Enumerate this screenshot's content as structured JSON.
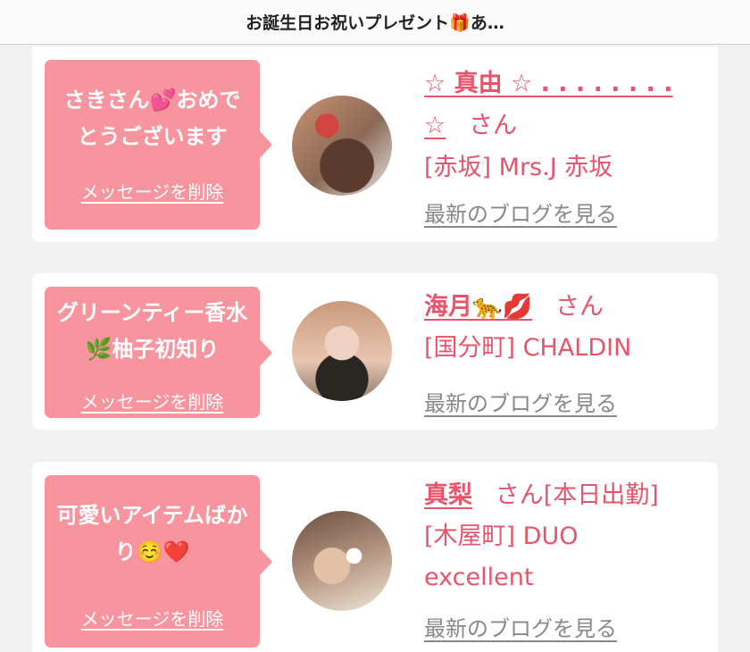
{
  "header": {
    "title": "お誕生日お祝いプレゼント🎁あ…"
  },
  "cards": [
    {
      "message": "さきさん💕おめでとうございます",
      "delete_label": "メッセージを削除",
      "avatar_icon": "profile-photo",
      "name_line1": "☆ 真由 ☆ . . . . . . . .",
      "name_line2": "☆",
      "san": "さん",
      "shop": "[赤坂] Mrs.J 赤坂",
      "blog_label": "最新のブログを見る"
    },
    {
      "message": "グリーンティー香水🌿柚子初知り",
      "delete_label": "メッセージを削除",
      "avatar_icon": "profile-photo",
      "name": "海月🐆💋",
      "san": "さん",
      "shop": "[国分町] CHALDIN",
      "blog_label": "最新のブログを見る"
    },
    {
      "message": "可愛いアイテムばかり☺️❤️",
      "delete_label": "メッセージを削除",
      "avatar_icon": "profile-photo",
      "name": "真梨",
      "san": "さん[本日出勤]",
      "shop_line1": "[木屋町] DUO",
      "shop_line2": "excellent",
      "blog_label": "最新のブログを見る"
    }
  ],
  "colors": {
    "bubble": "#f7949e",
    "accent": "#e8546b",
    "link_gray": "#888888"
  }
}
